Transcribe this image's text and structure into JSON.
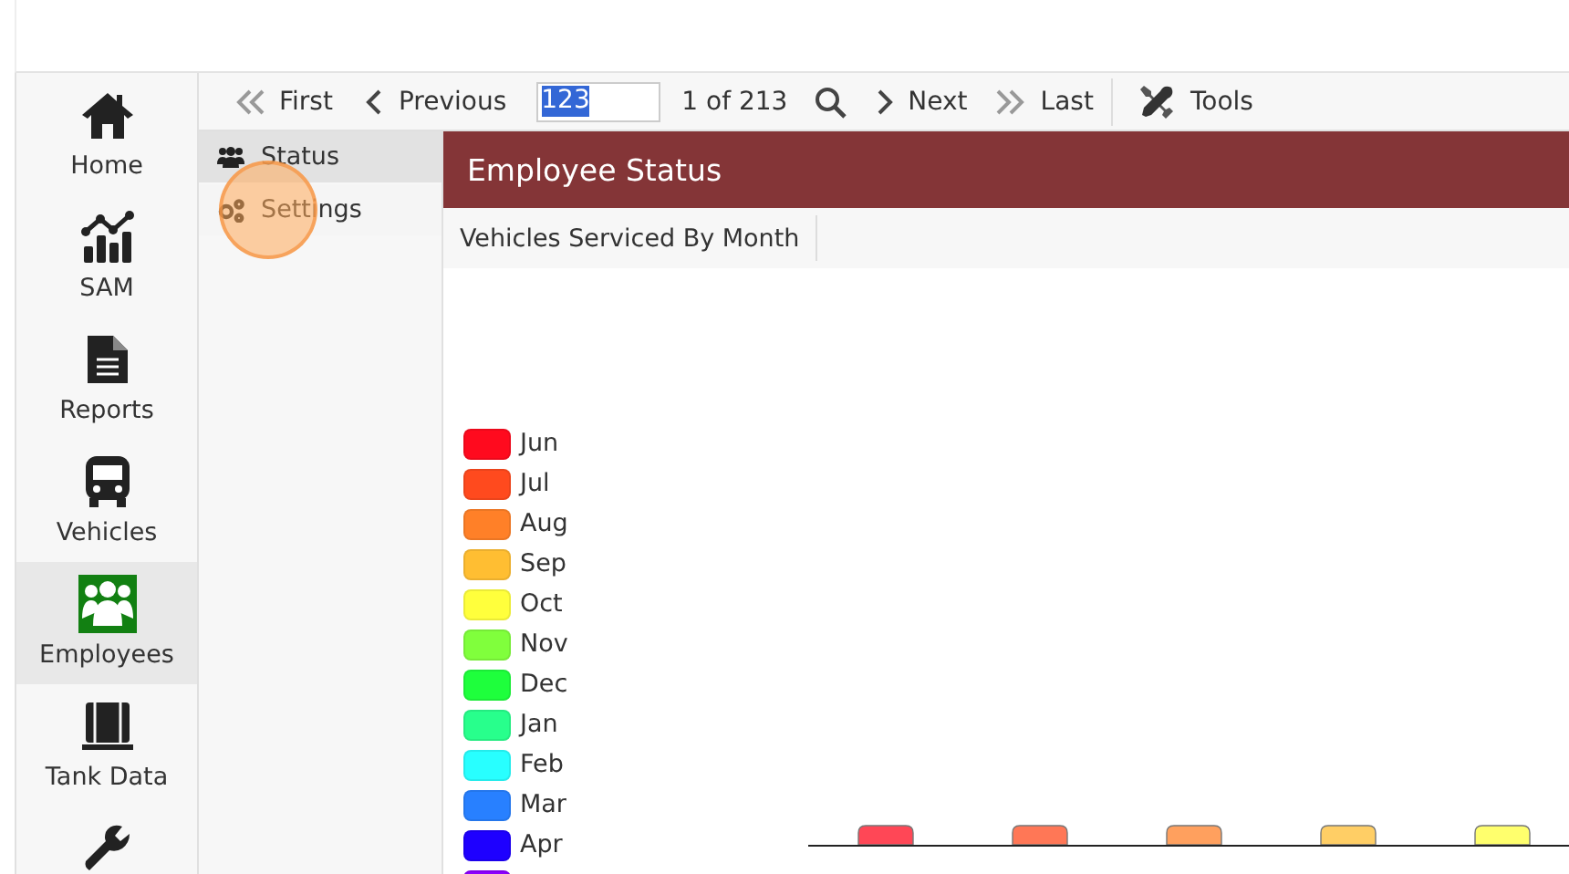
{
  "nav": [
    {
      "label": "Home",
      "selected": false
    },
    {
      "label": "SAM",
      "selected": false
    },
    {
      "label": "Reports",
      "selected": false
    },
    {
      "label": "Vehicles",
      "selected": false
    },
    {
      "label": "Employees",
      "selected": true
    },
    {
      "label": "Tank Data",
      "selected": false
    },
    {
      "selected": false
    }
  ],
  "toolbar": {
    "first": "First",
    "previous": "Previous",
    "page_input": {
      "value": "123"
    },
    "page_count": "1 of 213",
    "next": "Next",
    "last": "Last",
    "tools": "Tools"
  },
  "submenu": [
    {
      "label": "Status",
      "selected": true,
      "clicked": false
    },
    {
      "label": "Settings",
      "selected": false,
      "clicked": true
    }
  ],
  "header": "Employee Status",
  "tabs": [
    {
      "label": "Vehicles Serviced By Month"
    }
  ],
  "legend": [
    {
      "label": "Jun",
      "color": "#ff0a1e"
    },
    {
      "label": "Jul",
      "color": "#ff4a1e"
    },
    {
      "label": "Aug",
      "color": "#ff8028"
    },
    {
      "label": "Sep",
      "color": "#ffbe32"
    },
    {
      "label": "Oct",
      "color": "#ffff3c"
    },
    {
      "label": "Nov",
      "color": "#80ff3c"
    },
    {
      "label": "Dec",
      "color": "#1eff3c"
    },
    {
      "label": "Jan",
      "color": "#28ff8c"
    },
    {
      "label": "Feb",
      "color": "#28ffff"
    },
    {
      "label": "Mar",
      "color": "#2880ff"
    },
    {
      "label": "Apr",
      "color": "#1e00ff"
    },
    {
      "color": "#8c00ff"
    }
  ]
}
